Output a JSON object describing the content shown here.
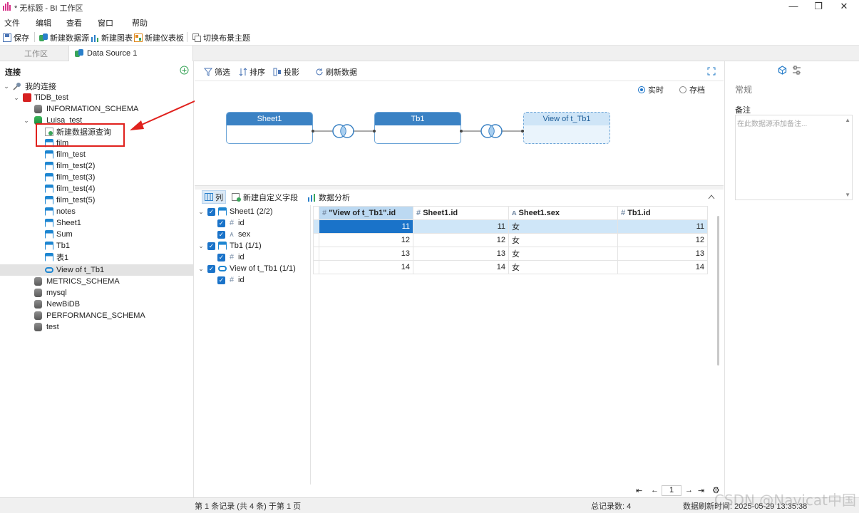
{
  "window": {
    "title": "* 无标题 - BI 工作区",
    "min": "—",
    "max": "❐",
    "close": "✕"
  },
  "menu": [
    "文件",
    "编辑",
    "查看",
    "窗口",
    "帮助"
  ],
  "toolbar": {
    "save": "保存",
    "new_datasource": "新建数据源",
    "new_chart": "新建图表",
    "new_dashboard": "新建仪表板",
    "switch_theme": "切换布景主题"
  },
  "tabs": {
    "workspace": "工作区",
    "datasource": "Data Source 1"
  },
  "left": {
    "header": "连接",
    "add_icon": "plus-circle-icon",
    "root": "我的连接",
    "tidb": "TiDB_test",
    "info_schema": "INFORMATION_SCHEMA",
    "luisa": "Luisa_test",
    "new_query": "新建数据源查询",
    "tables": [
      "film",
      "film_test",
      "film_test(2)",
      "film_test(3)",
      "film_test(4)",
      "film_test(5)",
      "notes",
      "Sheet1",
      "Sum",
      "Tb1",
      "表1"
    ],
    "view": "View of t_Tb1",
    "schemas": [
      "METRICS_SCHEMA",
      "mysql",
      "NewBiDB",
      "PERFORMANCE_SCHEMA",
      "test"
    ]
  },
  "mid_toolbar": {
    "filter": "筛选",
    "sort": "排序",
    "project": "投影",
    "refresh": "刷新数据"
  },
  "mode": {
    "realtime": "实时",
    "archive": "存档",
    "selected": "realtime"
  },
  "nodes": {
    "a": "Sheet1",
    "b": "Tb1",
    "c": "View of t_Tb1"
  },
  "grid_toolbar": {
    "columns": "列",
    "new_field": "新建自定义字段",
    "analysis": "数据分析"
  },
  "coltree": {
    "g1": "Sheet1 (2/2)",
    "g1_id": "id",
    "g1_sex": "sex",
    "g2": "Tb1 (1/1)",
    "g2_id": "id",
    "g3": "View of t_Tb1 (1/1)",
    "g3_id": "id"
  },
  "table": {
    "headers": [
      "\"View of t_Tb1\".id",
      "Sheet1.id",
      "Sheet1.sex",
      "Tb1.id"
    ],
    "rows": [
      [
        "11",
        "11",
        "女",
        "11"
      ],
      [
        "12",
        "12",
        "女",
        "12"
      ],
      [
        "13",
        "13",
        "女",
        "13"
      ],
      [
        "14",
        "14",
        "女",
        "14"
      ]
    ]
  },
  "pager": {
    "page": "1"
  },
  "right": {
    "section": "常规",
    "notes_label": "备注",
    "notes_placeholder": "在此数据源添加备注..."
  },
  "status": {
    "left": "第 1 条记录 (共 4 条) 于第 1 页",
    "total": "总记录数: 4",
    "refresh_time": "数据刷新时间: 2025-05-29 13:35:38"
  },
  "watermark": "CSDN @Navicat中国"
}
